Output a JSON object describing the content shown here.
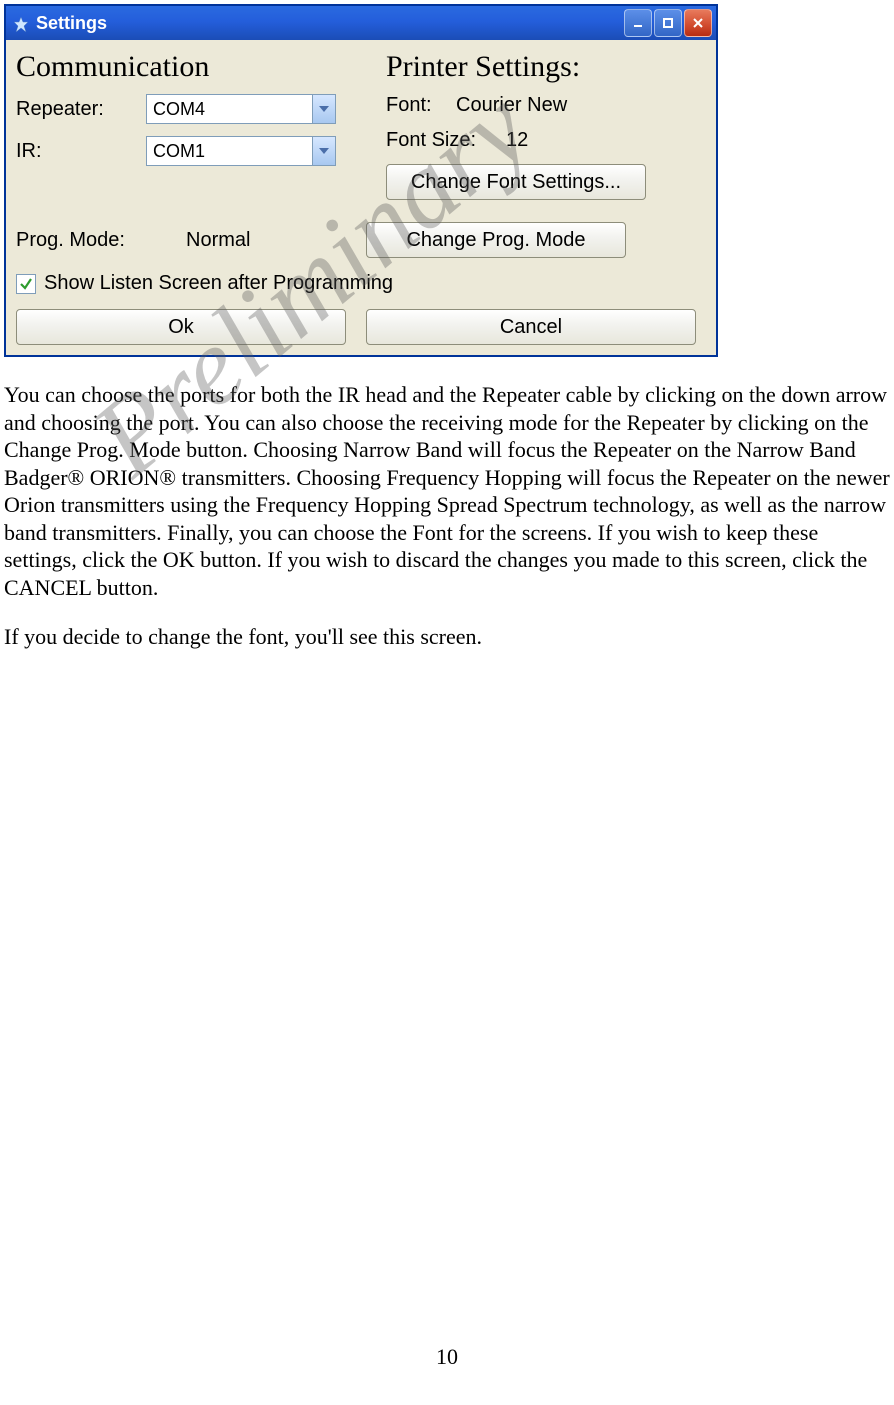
{
  "dialog": {
    "title": "Settings",
    "left_title": "Communication",
    "right_title": "Printer Settings:",
    "repeater_label": "Repeater:",
    "repeater_value": "COM4",
    "ir_label": "IR:",
    "ir_value": "COM1",
    "font_label": "Font:",
    "font_value": "Courier New",
    "fontsize_label": "Font Size:",
    "fontsize_value": "12",
    "change_font_btn": "Change Font Settings...",
    "prog_mode_label": "Prog. Mode:",
    "prog_mode_value": "Normal",
    "change_prog_btn": "Change Prog. Mode",
    "show_listen_label": "Show Listen Screen after Programming",
    "ok_btn": "Ok",
    "cancel_btn": "Cancel"
  },
  "doc": {
    "para1": "You can choose the ports for both the IR head and the Repeater cable  by clicking on the down arrow and choosing the port.  You can also choose the receiving mode for the Repeater by clicking on the Change Prog. Mode button.  Choosing Narrow Band will focus the Repeater on the Narrow Band Badger® ORION® transmitters.  Choosing Frequency Hopping will focus the Repeater on the newer Orion transmitters using the Frequency Hopping Spread Spectrum technology, as well as the narrow band transmitters.  Finally, you can choose the Font for the screens.  If you wish to keep these settings, click the OK button.  If you wish to discard the changes you made to this screen, click the CANCEL button.",
    "para2": "If you decide to change the font, you'll see this screen.",
    "watermark": "Preliminary",
    "pagenum": "10"
  }
}
